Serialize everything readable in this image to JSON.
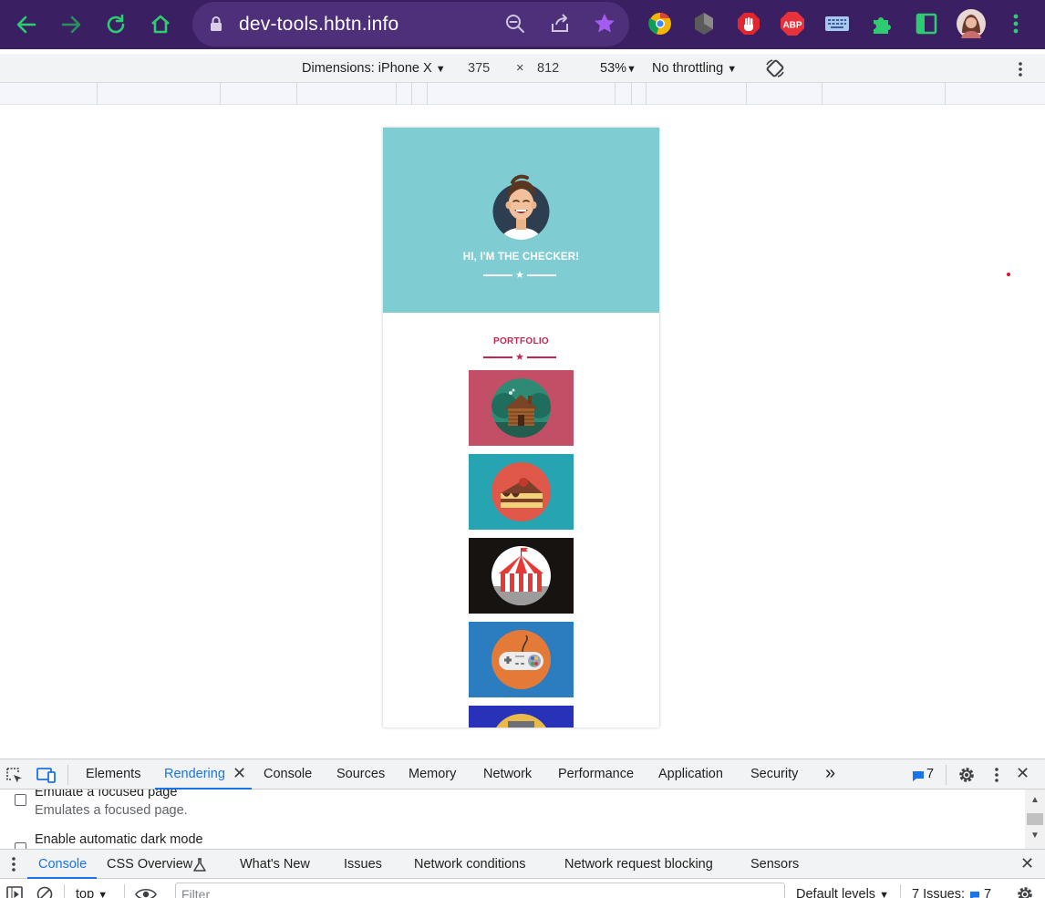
{
  "browser": {
    "url": "dev-tools.hbtn.info",
    "accent_color": "#2ecc71",
    "extensions": [
      "chrome-icon",
      "shield-dark-icon",
      "stop-hand-icon",
      "adblock-plus-icon",
      "keyboard-icon",
      "puzzle-icon",
      "sidebar-icon",
      "profile-avatar"
    ],
    "adblock_label": "ABP"
  },
  "device_toolbar": {
    "dimensions_label": "Dimensions: iPhone X",
    "width": "375",
    "times": "×",
    "height": "812",
    "zoom": "53%",
    "throttling": "No throttling"
  },
  "page": {
    "hero_title": "HI, I'M THE CHECKER!",
    "hero_color": "#7fcdd3",
    "portfolio_title": "PORTFOLIO",
    "portfolio_color": "#c7254e",
    "tiles": [
      {
        "name": "cabin",
        "bg": "#c24f66",
        "circle": "#2e8a75"
      },
      {
        "name": "cake",
        "bg": "#26a4b2",
        "circle": "#e0584a"
      },
      {
        "name": "circus",
        "bg": "#161310",
        "circle": "#ffffff"
      },
      {
        "name": "gamepad",
        "bg": "#2c7cc0",
        "circle": "#e37a37"
      },
      {
        "name": "safe",
        "bg": "#2732b8",
        "circle": "#e9b94a"
      }
    ]
  },
  "devtools": {
    "tabs": [
      "Elements",
      "Rendering",
      "Console",
      "Sources",
      "Memory",
      "Network",
      "Performance",
      "Application",
      "Security"
    ],
    "active_tab": "Rendering",
    "more_tabs": "»",
    "issues_count": "7",
    "rendering_options": [
      {
        "label": "Emulate a focused page",
        "desc": "Emulates a focused page."
      },
      {
        "label": "Enable automatic dark mode",
        "desc": ""
      }
    ],
    "drawer_tabs": [
      "Console",
      "CSS Overview",
      "What's New",
      "Issues",
      "Network conditions",
      "Network request blocking",
      "Sensors"
    ],
    "active_drawer_tab": "Console",
    "context": "top",
    "filter_placeholder": "Filter",
    "levels": "Default levels",
    "issues_label": "7 Issues:",
    "issues_badge": "7"
  }
}
